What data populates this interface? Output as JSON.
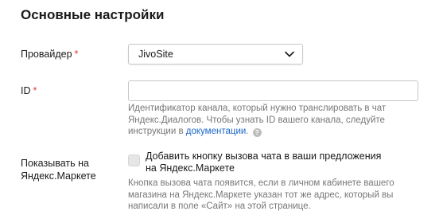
{
  "section": {
    "title": "Основные настройки"
  },
  "provider": {
    "label": "Провайдер",
    "required_mark": "*",
    "selected": "JivoSite"
  },
  "id_field": {
    "label": "ID",
    "required_mark": "*",
    "value": "",
    "hint_text": "Идентификатор канала, который нужно транслировать в чат Яндекс.Диалогов. Чтобы узнать ID вашего канала, следуйте инструкции в ",
    "hint_link": "документации",
    "hint_end": ".",
    "help_symbol": "?"
  },
  "market": {
    "label": "Показывать на Яндекс.Маркете",
    "checkbox_label": "Добавить кнопку вызова чата в ваши предложения на Яндекс.Маркете",
    "checked": false,
    "hint": "Кнопка вызова чата появится, если в личном кабинете вашего магазина на Яндекс.Маркете указан тот же адрес, который вы написали в поле «Сайт» на этой странице."
  },
  "colors": {
    "required": "#e33a2b",
    "link": "#1a66c9",
    "hint": "#777777"
  }
}
